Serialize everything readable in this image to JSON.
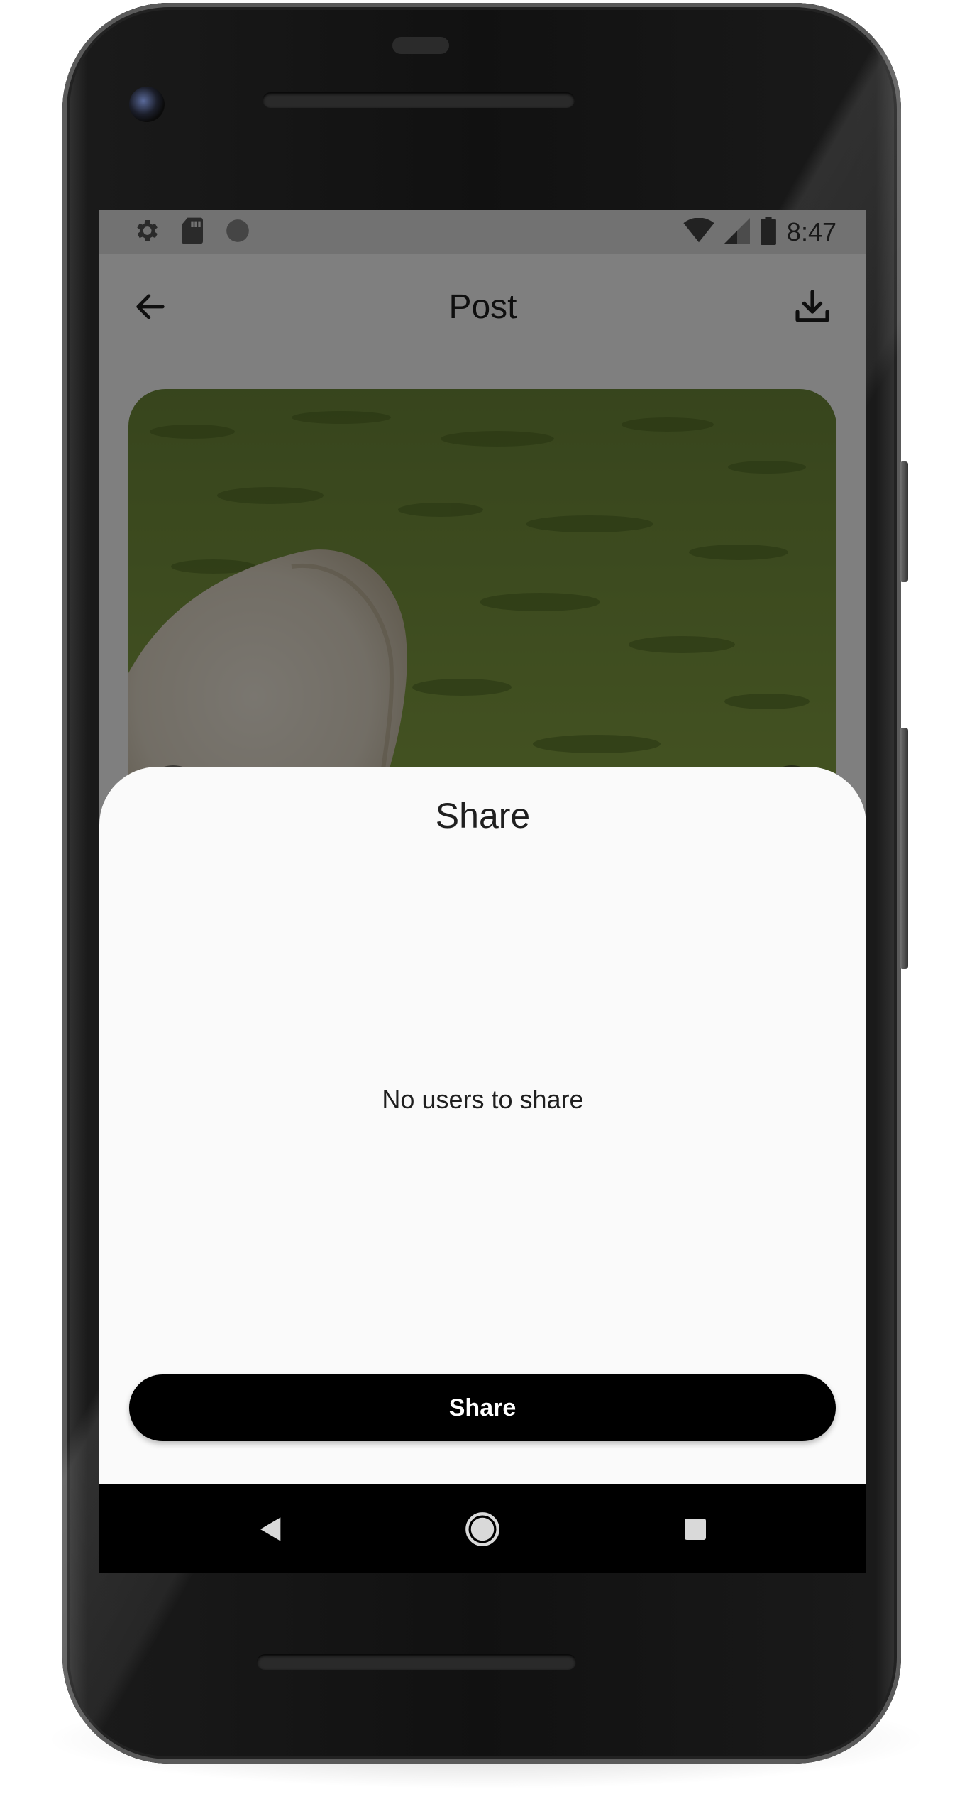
{
  "status_bar": {
    "time": "8:47",
    "icons": [
      "settings-icon",
      "sd-card-icon",
      "circle-icon",
      "wifi-icon",
      "signal-icon",
      "battery-icon"
    ]
  },
  "app_bar": {
    "title": "Post",
    "back_icon": "arrow-back-icon",
    "download_icon": "download-icon"
  },
  "post": {
    "image_description_icon": "sheep-photo",
    "prev_icon": "chevron-left-icon",
    "next_icon": "chevron-right-icon"
  },
  "share_sheet": {
    "title": "Share",
    "empty_message": "No users to share",
    "button_label": "Share"
  },
  "nav_bar": {
    "icons": [
      "nav-back-icon",
      "nav-home-icon",
      "nav-recents-icon"
    ]
  },
  "colors": {
    "scrim": "#000000",
    "sheet_background": "#fafafa",
    "button_background": "#000000",
    "button_text": "#ffffff"
  }
}
